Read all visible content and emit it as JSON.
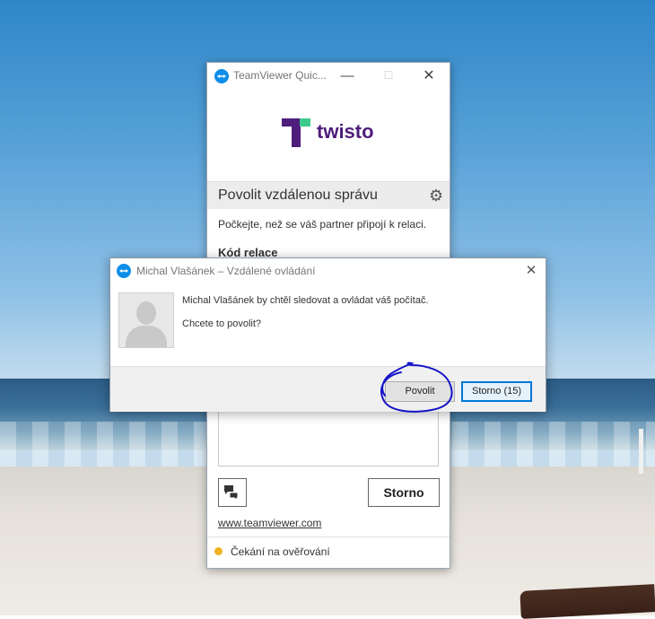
{
  "main_window": {
    "title": "TeamViewer Quic...",
    "controls": {
      "minimize": "—",
      "maximize": "☐",
      "close": "✕"
    },
    "brand_name": "twisto",
    "section_title": "Povolit vzdálenou správu",
    "wait_message": "Počkejte, než se váš partner připojí k relaci.",
    "session_code_label": "Kód relace",
    "cancel_button": "Storno",
    "website_link": "www.teamviewer.com",
    "status_text": "Čekání na ověřování"
  },
  "dialog": {
    "title": "Michal Vlašánek – Vzdálené ovládání",
    "close": "✕",
    "message": "Michal Vlašánek by chtěl sledovat a ovládat váš počítač.",
    "question": "Chcete to povolit?",
    "allow_button": "Povolit",
    "cancel_button": "Storno (15)"
  },
  "colors": {
    "brand_purple": "#4f1d7c",
    "brand_green": "#3ec98c",
    "teamviewer_blue": "#0e8ee9",
    "status_pending": "#f0b323",
    "focus_blue": "#0078d7"
  },
  "icons": {
    "settings": "gear-icon",
    "chat": "chat-icon",
    "avatar": "user-avatar-placeholder"
  }
}
